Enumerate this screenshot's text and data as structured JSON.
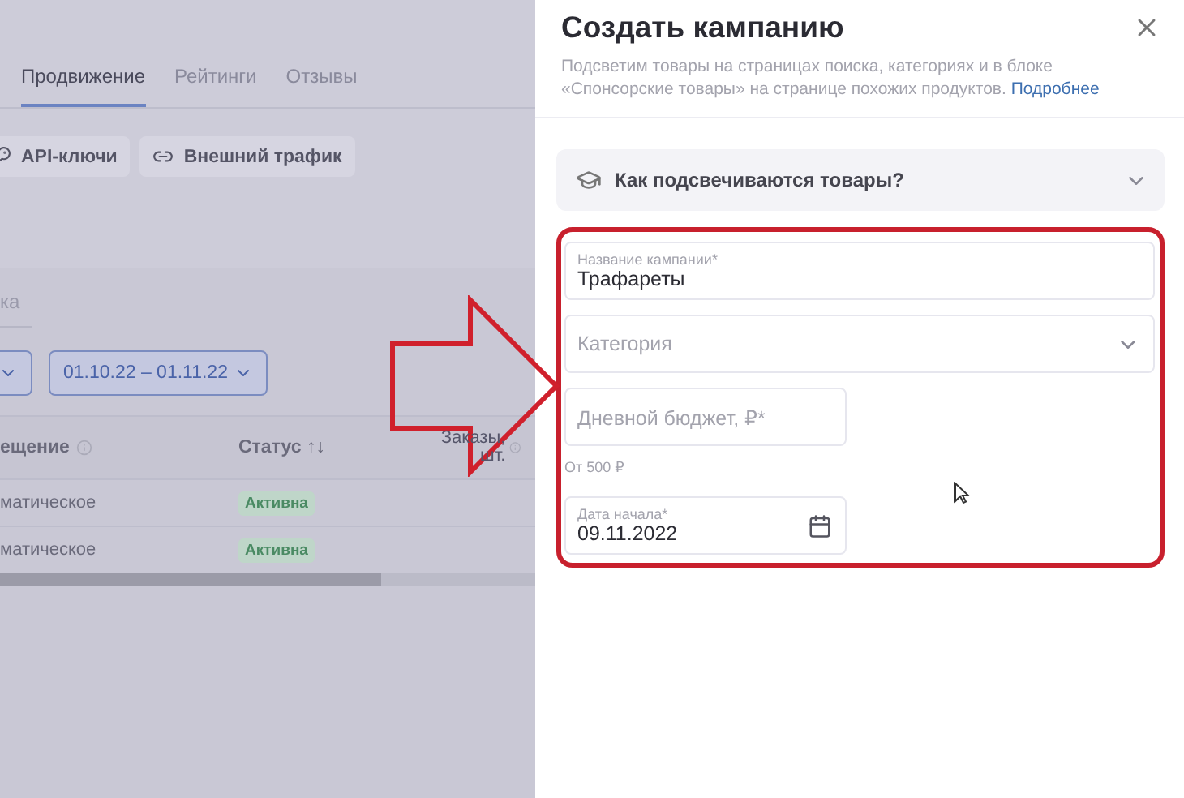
{
  "background_page": {
    "tabs": [
      {
        "label": "Продвижение",
        "selected": true
      },
      {
        "label": "Рейтинги",
        "selected": false
      },
      {
        "label": "Отзывы",
        "selected": false
      }
    ],
    "toolbar_buttons": [
      {
        "label": "API-ключи",
        "kind": "key"
      },
      {
        "label": "Внешний трафик",
        "kind": "link"
      }
    ],
    "subtab": {
      "label": "ка"
    },
    "date_range": {
      "label": "01.10.22 – 01.11.22"
    },
    "table": {
      "columns": [
        {
          "label": "ещение",
          "info": true
        },
        {
          "label": "Статус ↑↓",
          "info": false
        },
        {
          "label": "Заказы, шт.",
          "info": true
        }
      ],
      "rows": [
        {
          "placement": "матическое",
          "status": "Активна"
        },
        {
          "placement": "матическое",
          "status": "Активна"
        }
      ]
    }
  },
  "panel": {
    "title": "Создать кампанию",
    "description": "Подсветим товары на страницах поиска, категориях и в блоке «Спонсорские товары» на странице похожих продуктов.",
    "link": "Подробнее",
    "accordion": {
      "label": "Как подсвечиваются товары?",
      "expanded": false
    },
    "fields": [
      {
        "kind": "text",
        "label": "Название кампании*",
        "value": "Трафареты"
      },
      {
        "kind": "select",
        "placeholder": "Категория"
      },
      {
        "kind": "short",
        "placeholder": "Дневной бюджет, ₽*",
        "hint": "От 500 ₽"
      },
      {
        "kind": "date",
        "label": "Дата начала*",
        "value": "09.11.2022"
      }
    ]
  }
}
